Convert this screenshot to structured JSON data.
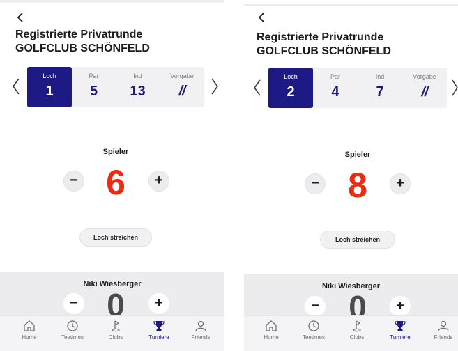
{
  "screens": [
    {
      "title_line1": "Registrierte Privatrunde",
      "title_line2": "GOLFCLUB SCHÖNFELD",
      "hole": {
        "loch_label": "Loch",
        "loch_value": "1",
        "par_label": "Par",
        "par_value": "5",
        "ind_label": "Ind",
        "ind_value": "13",
        "vorgabe_label": "Vorgabe",
        "vorgabe_value": "//"
      },
      "player_label": "Spieler",
      "player_score": "6",
      "minus": "−",
      "plus": "+",
      "strike_button": "Loch streichen",
      "friend_name": "Niki Wiesberger",
      "friend_score": "0"
    },
    {
      "title_line1": "Registrierte Privatrunde",
      "title_line2": "GOLFCLUB SCHÖNFELD",
      "hole": {
        "loch_label": "Loch",
        "loch_value": "2",
        "par_label": "Par",
        "par_value": "4",
        "ind_label": "Ind",
        "ind_value": "7",
        "vorgabe_label": "Vorgabe",
        "vorgabe_value": "//"
      },
      "player_label": "Spieler",
      "player_score": "8",
      "minus": "−",
      "plus": "+",
      "strike_button": "Loch streichen",
      "friend_name": "Niki Wiesberger",
      "friend_score": "0"
    }
  ],
  "tabs": [
    {
      "label": "Home",
      "icon": "home-icon"
    },
    {
      "label": "Teetimes",
      "icon": "clock-icon"
    },
    {
      "label": "Clubs",
      "icon": "flag-icon"
    },
    {
      "label": "Turniere",
      "icon": "trophy-icon",
      "active": true
    },
    {
      "label": "Friends",
      "icon": "person-icon"
    }
  ],
  "colors": {
    "accent": "#1d1a85",
    "score": "#ee2a12",
    "card_bg": "#f1f1f3",
    "bottom_bg": "#ececee"
  }
}
